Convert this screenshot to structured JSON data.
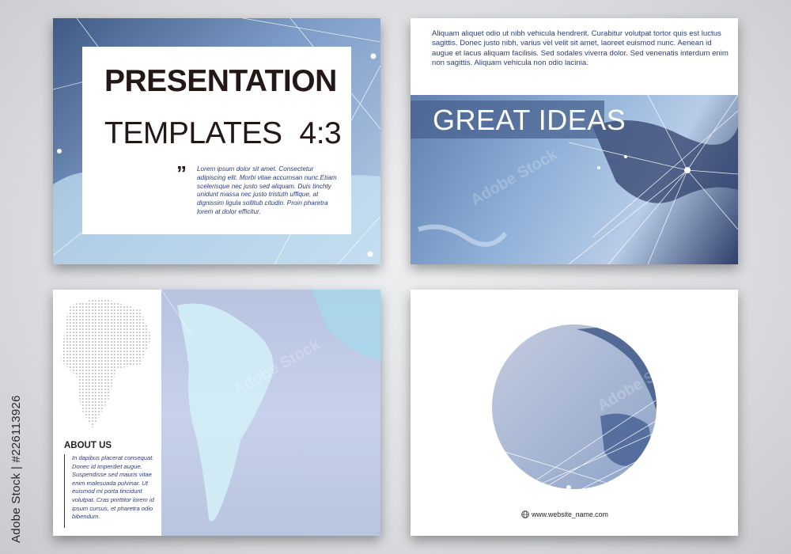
{
  "slide1": {
    "title_line1": "PRESENTATION",
    "title_line2": "TEMPLATES",
    "title_ratio": "4:3",
    "quote_mark": "”",
    "body": "Lorem ipsum dolor sit amet. Consectetur adipiscing elit. Morbi vitae accumsan nunc.Etiam scelerisque nec justo sed aliquam. Duis tinchty unidunt massa nec justo tristuth ufflque, at dignissim ligula sollitub citudin. Proin pharetra lorem at dolor efficitur."
  },
  "slide2": {
    "body": "Aliquam aliquet odio ut nibh vehicula hendrerit. Curabitur volutpat tortor quis est luctus sagittis. Donec justo nibh, varius vel velit sit amet, laoreet euismod nunc. Aenean id augue et lacus aliquam facilisis. Sed sodales viverra dolor. Sed venenatis interdum enim non sagittis. Aliquam vehicula non odio lacinia.",
    "banner": "GREAT IDEAS"
  },
  "slide3": {
    "heading": "ABOUT US",
    "body": "In dapibus placerat consequat. Donec id imperdiet augue. Suspendisse sed mauris vitae enim malesuada pulvinar. Ut euismod mi porta tincidunt volutpat. Cras porttitor lorem id ipsum cursus, et pharetra odio bibendum."
  },
  "slide4": {
    "url": "www.website_name.com"
  },
  "stock_id": "Adobe Stock | #226113926",
  "watermark": "Adobe Stock",
  "colors": {
    "page_bg": "#d9dadc",
    "title_text": "#231815",
    "body_text": "#2c3e7a",
    "accent_blue": "#4a6fa5"
  }
}
